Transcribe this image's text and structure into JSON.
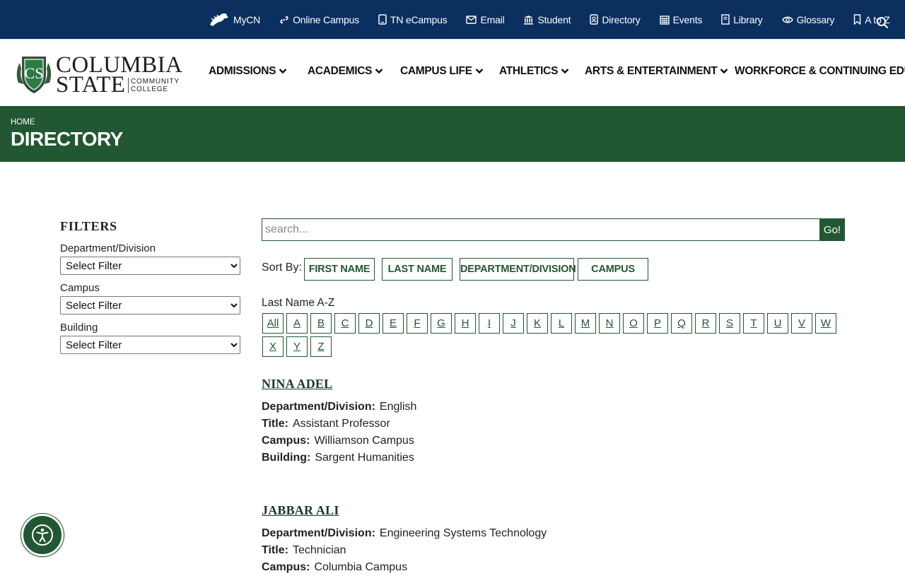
{
  "utility_links": [
    {
      "label": "MyCN",
      "icon": "charger-horse-icon"
    },
    {
      "label": "Online Campus",
      "icon": "link-icon"
    },
    {
      "label": "TN eCampus",
      "icon": "tablet-icon"
    },
    {
      "label": "Email",
      "icon": "envelope-icon"
    },
    {
      "label": "Student",
      "icon": "building-columns-icon"
    },
    {
      "label": "Directory",
      "icon": "address-book-icon"
    },
    {
      "label": "Events",
      "icon": "calendar-icon"
    },
    {
      "label": "Library",
      "icon": "book-icon"
    },
    {
      "label": "Glossary",
      "icon": "eye-icon"
    },
    {
      "label": "A to Z",
      "icon": "bookmark-icon"
    }
  ],
  "logo": {
    "line1": "COLUMBIA",
    "line2": "STATE",
    "sub1": "COMMUNITY",
    "sub2": "COLLEGE",
    "monogram": "CS"
  },
  "nav": [
    {
      "label": "ADMISSIONS"
    },
    {
      "label": "ACADEMICS"
    },
    {
      "label": "CAMPUS LIFE"
    },
    {
      "label": "ATHLETICS"
    },
    {
      "label": "ARTS & ENTERTAINMENT"
    },
    {
      "label": "WORKFORCE & CONTINUING EDU"
    }
  ],
  "banner": {
    "breadcrumb": "HOME",
    "title": "DIRECTORY"
  },
  "filters": {
    "heading": "FILTERS",
    "groups": [
      {
        "label": "Department/Division",
        "selected": "Select Filter"
      },
      {
        "label": "Campus",
        "selected": "Select Filter"
      },
      {
        "label": "Building",
        "selected": "Select Filter"
      }
    ]
  },
  "search": {
    "placeholder": "search...",
    "value": "",
    "button": "Go!"
  },
  "sort": {
    "label": "Sort By:",
    "buttons": [
      "FIRST NAME",
      "LAST NAME",
      "DEPARTMENT/DIVISION",
      "CAMPUS"
    ]
  },
  "alphabet": {
    "label": "Last Name A-Z",
    "letters": [
      "All",
      "A",
      "B",
      "C",
      "D",
      "E",
      "F",
      "G",
      "H",
      "I",
      "J",
      "K",
      "L",
      "M",
      "N",
      "O",
      "P",
      "Q",
      "R",
      "S",
      "T",
      "U",
      "V",
      "W",
      "X",
      "Y",
      "Z"
    ]
  },
  "entries": [
    {
      "name": "NINA ADEL",
      "fields": [
        {
          "key": "Department/Division:",
          "value": "English"
        },
        {
          "key": "Title:",
          "value": "Assistant Professor"
        },
        {
          "key": "Campus:",
          "value": "Williamson Campus"
        },
        {
          "key": "Building:",
          "value": "Sargent Humanities"
        }
      ]
    },
    {
      "name": "JABBAR ALI",
      "fields": [
        {
          "key": "Department/Division:",
          "value": "Engineering Systems Technology"
        },
        {
          "key": "Title:",
          "value": "Technician"
        },
        {
          "key": "Campus:",
          "value": "Columbia Campus"
        }
      ]
    }
  ],
  "colors": {
    "navy": "#0b2f5e",
    "green": "#215733",
    "text": "#222222"
  }
}
